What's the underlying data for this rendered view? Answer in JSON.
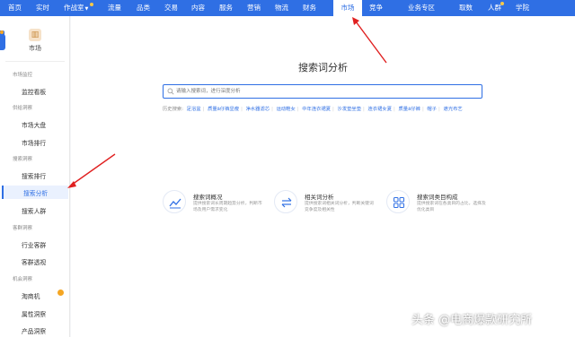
{
  "topnav": {
    "items": [
      "首页",
      "实时",
      "作战室",
      "流量",
      "品类",
      "交易",
      "内容",
      "服务",
      "营销",
      "物流",
      "财务",
      "市场",
      "竞争",
      "业务专区",
      "取数",
      "人群",
      "学院"
    ],
    "active": "市场"
  },
  "sidebar": {
    "header_label": "市场",
    "groups": [
      {
        "label": "市场监控",
        "items": [
          "监控看板"
        ]
      },
      {
        "label": "供给洞察",
        "items": [
          "市场大盘",
          "市场排行"
        ]
      },
      {
        "label": "搜索洞察",
        "items": [
          "搜索排行",
          "搜索分析",
          "搜索人群"
        ]
      },
      {
        "label": "客群洞察",
        "items": [
          "行业客群",
          "客群透视"
        ]
      },
      {
        "label": "机会洞察",
        "items": [
          "淘商机",
          "属性洞察",
          "产品洞察"
        ]
      }
    ],
    "active_item": "搜索分析"
  },
  "main": {
    "title": "搜索词分析",
    "search_placeholder": "请输入搜索词，进行深度分析",
    "history_label": "历史搜索:",
    "history": [
      "足浴盆",
      "质量ä仔裤显瘦",
      "净水器滤芯",
      "运动鞋女",
      "中年连衣裙夏",
      "沙发垫坐垫",
      "连衣裙女夏",
      "质量ä仔裤",
      "帽子",
      "遮光布艺"
    ],
    "features": [
      {
        "icon": "chart-icon",
        "title": "搜索词概况",
        "desc": "提供搜索词长周期趋势分析，判断市场及用户需求变化"
      },
      {
        "icon": "swap-icon",
        "title": "相关词分析",
        "desc": "提供搜索词相关词分析，判断关键词竞争度及相关性"
      },
      {
        "icon": "grid-icon",
        "title": "搜索词类目构成",
        "desc": "提供搜索词在各类目的占比，选择及优化类目"
      }
    ]
  },
  "watermark": "头条 @电商爆款研究所",
  "colors": {
    "primary": "#2f6fe4",
    "arrow": "#e02020",
    "orange": "#f5a623"
  }
}
